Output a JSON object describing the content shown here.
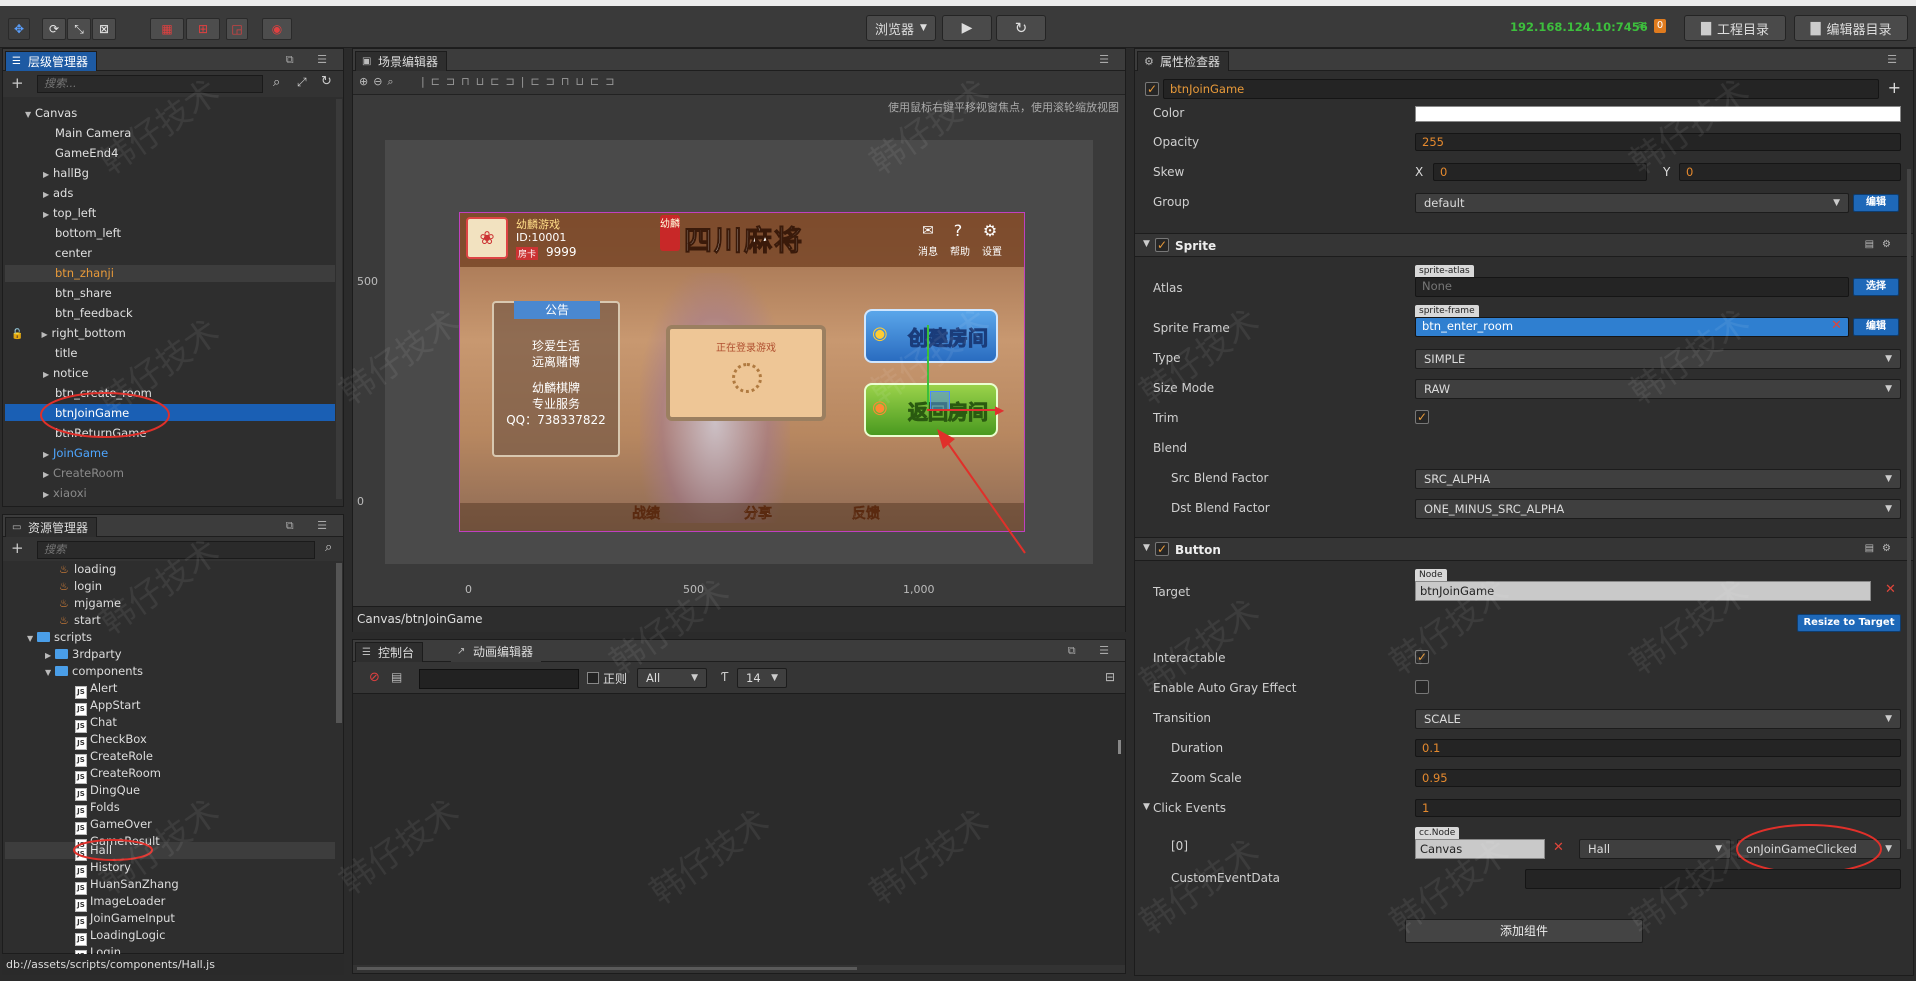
{
  "toolbar": {
    "preview_select": "浏览器",
    "ip_address": "192.168.124.10:7456",
    "wifi_count": "0",
    "project_dir": "工程目录",
    "editor_dir": "编辑器目录"
  },
  "hierarchy": {
    "title": "层级管理器",
    "search_placeholder": "搜索...",
    "items": [
      {
        "label": "Canvas"
      },
      {
        "label": "Main Camera"
      },
      {
        "label": "GameEnd4"
      },
      {
        "label": "hallBg"
      },
      {
        "label": "ads"
      },
      {
        "label": "top_left"
      },
      {
        "label": "bottom_left"
      },
      {
        "label": "center"
      },
      {
        "label": "btn_zhanji"
      },
      {
        "label": "btn_share"
      },
      {
        "label": "btn_feedback"
      },
      {
        "label": "right_bottom"
      },
      {
        "label": "title"
      },
      {
        "label": "notice"
      },
      {
        "label": "btn_create_room"
      },
      {
        "label": "btnJoinGame"
      },
      {
        "label": "btnReturnGame"
      },
      {
        "label": "JoinGame"
      },
      {
        "label": "CreateRoom"
      },
      {
        "label": "xiaoxi"
      }
    ]
  },
  "assets": {
    "title": "资源管理器",
    "search_placeholder": "搜索",
    "items": [
      {
        "label": "loading"
      },
      {
        "label": "login"
      },
      {
        "label": "mjgame"
      },
      {
        "label": "start"
      },
      {
        "label": "scripts"
      },
      {
        "label": "3rdparty"
      },
      {
        "label": "components"
      },
      {
        "label": "Alert"
      },
      {
        "label": "AppStart"
      },
      {
        "label": "Chat"
      },
      {
        "label": "CheckBox"
      },
      {
        "label": "CreateRole"
      },
      {
        "label": "CreateRoom"
      },
      {
        "label": "DingQue"
      },
      {
        "label": "Folds"
      },
      {
        "label": "GameOver"
      },
      {
        "label": "GameResult"
      },
      {
        "label": "Hall"
      },
      {
        "label": "History"
      },
      {
        "label": "HuanSanZhang"
      },
      {
        "label": "ImageLoader"
      },
      {
        "label": "JoinGameInput"
      },
      {
        "label": "LoadingLogic"
      },
      {
        "label": "Login"
      }
    ],
    "status_path": "db://assets/scripts/components/Hall.js"
  },
  "scene": {
    "title": "场景编辑器",
    "hint": "使用鼠标右键平移视窗焦点，使用滚轮缩放视图",
    "ruler_y": [
      "500",
      "0"
    ],
    "ruler_x": [
      "0",
      "500",
      "1,000"
    ],
    "breadcrumb": "Canvas/btnJoinGame",
    "game": {
      "brand": "幼麟游戏",
      "id": "ID:10001",
      "card_label": "房卡",
      "card_count": "9999",
      "logo_title": "四川麻将",
      "logo_tag": "幼麟",
      "top_icons": [
        "消息",
        "帮助",
        "设置"
      ],
      "notice_title": "公告",
      "notice_lines": [
        "珍爱生活",
        "远离赌博",
        "幼麟棋牌",
        "专业服务",
        "QQ：738337822"
      ],
      "loading_text": "正在登录游戏",
      "btn_create": "创建房间",
      "btn_join": "返回房间",
      "bottom_buttons": [
        "战绩",
        "分享",
        "反馈"
      ]
    }
  },
  "console": {
    "tab_console": "控制台",
    "tab_anim": "动画编辑器",
    "regex_label": "正则",
    "level_select": "All",
    "font_size": "14"
  },
  "inspector": {
    "title": "属性检查器",
    "node_name": "btnJoinGame",
    "color_label": "Color",
    "opacity_label": "Opacity",
    "opacity_value": "255",
    "skew_label": "Skew",
    "skew_x_label": "X",
    "skew_x": "0",
    "skew_y_label": "Y",
    "skew_y": "0",
    "group_label": "Group",
    "group_value": "default",
    "edit_btn": "编辑",
    "sprite_section": "Sprite",
    "atlas_label": "Atlas",
    "atlas_tag": "sprite-atlas",
    "atlas_value": "None",
    "select_btn": "选择",
    "sprite_frame_label": "Sprite Frame",
    "sprite_frame_tag": "sprite-frame",
    "sprite_frame_value": "btn_enter_room",
    "type_label": "Type",
    "type_value": "SIMPLE",
    "size_mode_label": "Size Mode",
    "size_mode_value": "RAW",
    "trim_label": "Trim",
    "blend_label": "Blend",
    "src_blend_label": "Src Blend Factor",
    "src_blend_value": "SRC_ALPHA",
    "dst_blend_label": "Dst Blend Factor",
    "dst_blend_value": "ONE_MINUS_SRC_ALPHA",
    "button_section": "Button",
    "target_label": "Target",
    "target_tag": "Node",
    "target_value": "btnJoinGame",
    "resize_btn": "Resize to Target",
    "interactable_label": "Interactable",
    "auto_gray_label": "Enable Auto Gray Effect",
    "transition_label": "Transition",
    "transition_value": "SCALE",
    "duration_label": "Duration",
    "duration_value": "0.1",
    "zoom_scale_label": "Zoom Scale",
    "zoom_scale_value": "0.95",
    "click_events_label": "Click Events",
    "click_events_value": "1",
    "event_index": "[0]",
    "event_tag": "cc.Node",
    "event_node": "Canvas",
    "event_component": "Hall",
    "event_handler": "onJoinGameClicked",
    "custom_event_label": "CustomEventData",
    "add_component_btn": "添加组件"
  },
  "watermark": "韩仔技术",
  "colors": {
    "accent": "#1d5aa3",
    "orange": "#e89a3a",
    "annotation_red": "#e0302a",
    "ip_green": "#3dbf3d"
  }
}
